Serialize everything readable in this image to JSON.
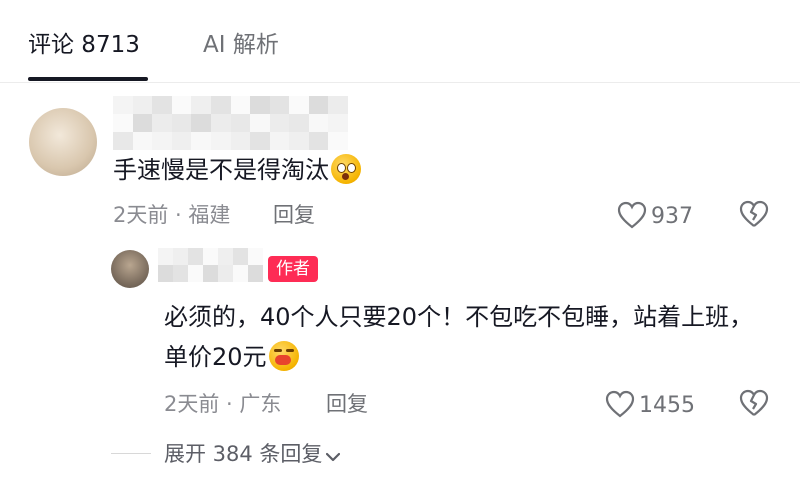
{
  "tabs": [
    {
      "label": "评论 8713"
    },
    {
      "label": "AI 解析"
    }
  ],
  "comment": {
    "text": "手速慢是不是得淘汰",
    "emoji": "shocked-emoji",
    "meta": "2天前 · 福建",
    "reply_label": "回复",
    "likes": "937"
  },
  "reply": {
    "badge": "作者",
    "text": "必须的，40个人只要20个！不包吃不包睡，站着上班，单价20元",
    "emoji": "yawning-emoji",
    "meta": "2天前 · 广东",
    "reply_label": "回复",
    "likes": "1455"
  },
  "expand": {
    "label": "展开 384 条回复"
  },
  "colors": {
    "badge": "#fe2c55",
    "text": "#161823",
    "muted": "#8a8b91"
  }
}
